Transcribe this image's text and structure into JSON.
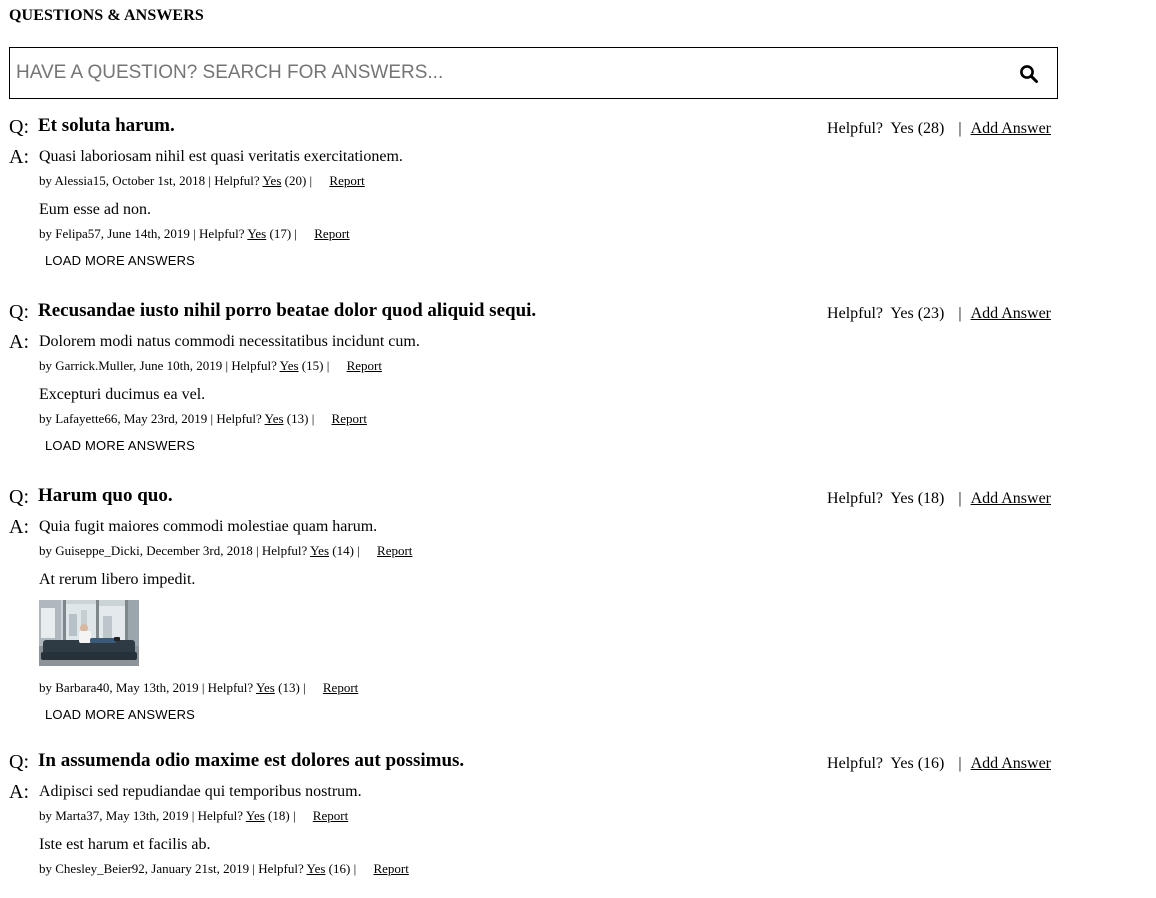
{
  "section_title": "QUESTIONS & ANSWERS",
  "search": {
    "placeholder": "HAVE A QUESTION? SEARCH FOR ANSWERS..."
  },
  "labels": {
    "q_prefix": "Q:",
    "a_prefix": "A:",
    "helpful": "Helpful?",
    "yes": "Yes",
    "separator": "|",
    "add_answer": "Add Answer",
    "report": "Report",
    "load_more": "LOAD MORE ANSWERS"
  },
  "questions": [
    {
      "text": "Et soluta harum.",
      "helpful_count": "(28)",
      "answers": [
        {
          "body": "Quasi laboriosam nihil est quasi veritatis exercitationem.",
          "byline": "by Alessia15, October 1st, 2018 | Helpful?",
          "count": "(20) |"
        },
        {
          "body": "Eum esse ad non.",
          "byline": "by Felipa57, June 14th, 2019 | Helpful?",
          "count": "(17) |"
        }
      ]
    },
    {
      "text": "Recusandae iusto nihil porro beatae dolor quod aliquid sequi.",
      "helpful_count": "(23)",
      "answers": [
        {
          "body": "Dolorem modi natus commodi necessitatibus incidunt cum.",
          "byline": "by Garrick.Muller, June 10th, 2019 | Helpful?",
          "count": "(15) |"
        },
        {
          "body": "Excepturi ducimus ea vel.",
          "byline": "by Lafayette66, May 23rd, 2019 | Helpful?",
          "count": "(13) |"
        }
      ]
    },
    {
      "text": "Harum quo quo.",
      "helpful_count": "(18)",
      "answers": [
        {
          "body": "Quia fugit maiores commodi molestiae quam harum.",
          "byline": "by Guiseppe_Dicki, December 3rd, 2018 | Helpful?",
          "count": "(14) |"
        },
        {
          "body": "At rerum libero impedit.",
          "byline": "by Barbara40, May 13th, 2019 | Helpful?",
          "count": "(13) |",
          "photo": "man-on-sofa-photo"
        }
      ]
    },
    {
      "text": "In assumenda odio maxime est dolores aut possimus.",
      "helpful_count": "(16)",
      "answers": [
        {
          "body": "Adipisci sed repudiandae qui temporibus nostrum.",
          "byline": "by Marta37, May 13th, 2019 | Helpful?",
          "count": "(18) |"
        },
        {
          "body": "Iste est harum et facilis ab.",
          "byline": "by Chesley_Beier92, January 21st, 2019 | Helpful?",
          "count": "(16) |"
        }
      ]
    }
  ],
  "icons": {
    "search": "search-icon"
  }
}
